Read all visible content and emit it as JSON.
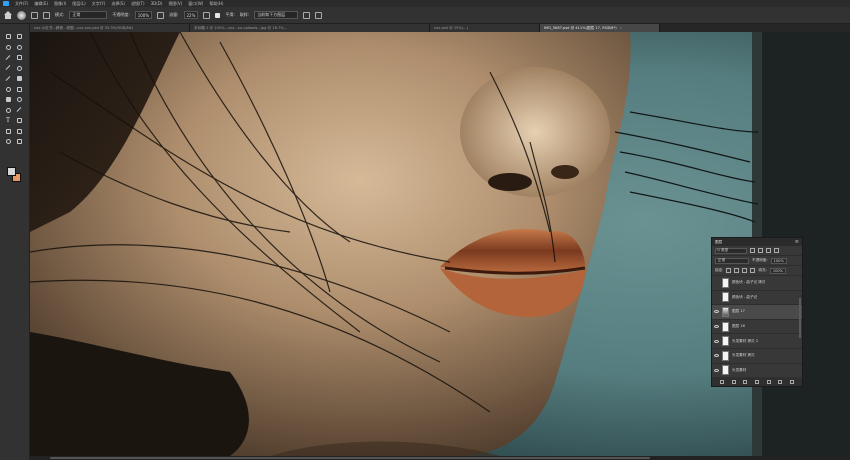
{
  "menubar": {
    "items": [
      "文件(F)",
      "编辑(E)",
      "图像(I)",
      "图层(L)",
      "文字(Y)",
      "选择(S)",
      "滤镜(T)",
      "3D(D)",
      "视图(V)",
      "窗口(W)",
      "帮助(H)"
    ],
    "colors": {
      "app_icon": "#2fa3f7"
    }
  },
  "options": {
    "mode_label": "模式:",
    "mode_value": "正常",
    "opacity_label": "不透明度:",
    "opacity_value": "100%",
    "flow_label": "流量:",
    "flow_value": "22%",
    "smoothing_label": "平滑:",
    "smoothing_value": "取样:",
    "sample_label": "当前和下方图层"
  },
  "tabs": [
    {
      "label": "xxx-小红书...精修...修图...xxx-xxx.psd @ 33.3%(RGB/8#)",
      "active": false
    },
    {
      "label": "未标题-1 @ 100%...xxx...xx-uploads...jpg @ 16.7%...",
      "active": false
    },
    {
      "label": "xxx.psd @ 25%(...)",
      "active": false
    },
    {
      "label": "IMG_5687.psd @ 411%(图层 17, RGB/8*)",
      "active": true
    }
  ],
  "tab_close": "×",
  "tools": [
    "move",
    "marquee",
    "lasso",
    "quick-select",
    "crop",
    "frame",
    "eyedropper",
    "spot-heal",
    "brush",
    "clone-stamp",
    "history-brush",
    "eraser",
    "gradient",
    "blur",
    "dodge",
    "pen",
    "text",
    "path-select",
    "rectangle",
    "hand",
    "zoom",
    "more"
  ],
  "text_tool_glyph": "T",
  "colors": {
    "foreground": "#d6d6d6",
    "background": "#e79965"
  },
  "layers_panel": {
    "title": "图层",
    "menu_glyph": "≡",
    "filter_placeholder": "Q 类型",
    "blend_mode": "正常",
    "opacity_label": "不透明度:",
    "opacity_value": "100%",
    "lock_label": "锁定:",
    "fill_label": "填充:",
    "fill_value": "100%",
    "layers": [
      {
        "name": "颜色块 - 曲子记 拷贝",
        "visible": false,
        "selected": false,
        "thumb": "white"
      },
      {
        "name": "颜色块 - 曲子记",
        "visible": false,
        "selected": false,
        "thumb": "white"
      },
      {
        "name": "图层 17",
        "visible": true,
        "selected": true,
        "thumb": "dark"
      },
      {
        "name": "图层 16",
        "visible": true,
        "selected": false,
        "thumb": "white"
      },
      {
        "name": "头发素材 拷贝 2",
        "visible": true,
        "selected": false,
        "thumb": "white"
      },
      {
        "name": "头发素材 拷贝",
        "visible": true,
        "selected": false,
        "thumb": "white"
      },
      {
        "name": "头发素材",
        "visible": true,
        "selected": false,
        "thumb": "white"
      }
    ]
  }
}
